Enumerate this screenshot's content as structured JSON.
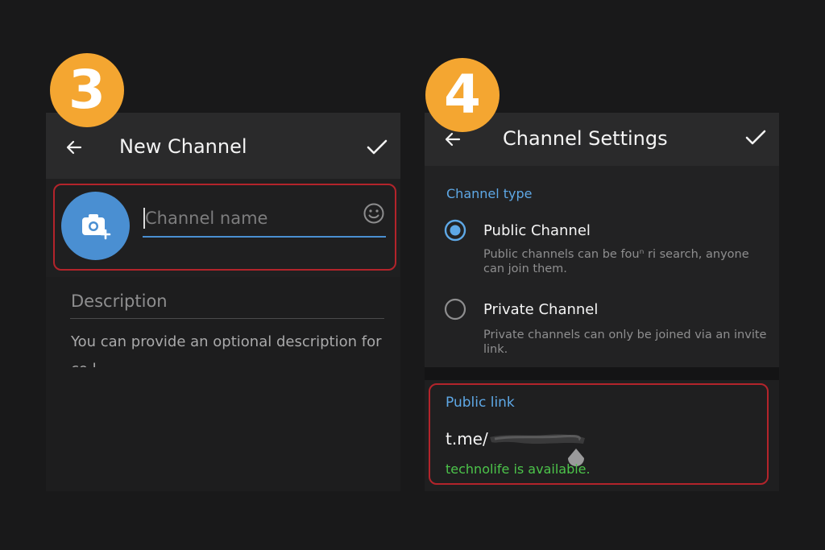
{
  "steps": {
    "left": "3",
    "right": "4"
  },
  "left_screen": {
    "title": "New Channel",
    "name_placeholder": "Channel name",
    "description_label": "Description",
    "description_hint": "You can provide an optional description for",
    "description_hint_cont": "co l"
  },
  "right_screen": {
    "title": "Channel Settings",
    "section_title": "Channel type",
    "options": [
      {
        "label": "Public Channel",
        "desc": "Public channels can be fouⁿ ri search, anyone",
        "desc2": "can join them.",
        "selected": true
      },
      {
        "label": "Private Channel",
        "desc": "Private channels can only be joined via an invite",
        "desc2": "link.",
        "selected": false
      }
    ],
    "link_title": "Public link",
    "link_prefix": "t.me/",
    "status": "technolife is available."
  },
  "colors": {
    "badge": "#f4a631",
    "accent_blue": "#5ea8e6",
    "available_green": "#4cc44a",
    "highlight_red": "#b3242b"
  }
}
